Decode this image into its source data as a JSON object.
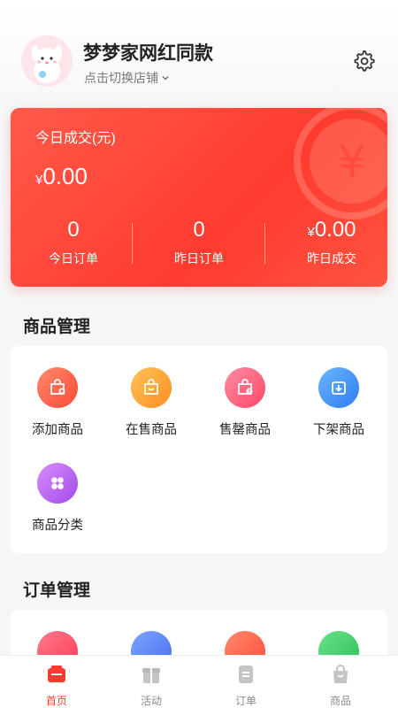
{
  "header": {
    "shop_name": "梦梦家网红同款",
    "switch_label": "点击切换店铺"
  },
  "stats": {
    "title": "今日成交(元)",
    "currency": "¥",
    "today_amount": "0.00",
    "items": [
      {
        "value": "0",
        "label": "今日订单",
        "currency": ""
      },
      {
        "value": "0",
        "label": "昨日订单",
        "currency": ""
      },
      {
        "value": "0.00",
        "label": "昨日成交",
        "currency": "¥"
      }
    ]
  },
  "product_management": {
    "title": "商品管理",
    "items": [
      {
        "label": "添加商品",
        "icon": "bag-add-icon",
        "color": "#ff5a4a"
      },
      {
        "label": "在售商品",
        "icon": "bag-smile-icon",
        "color": "#ffa530"
      },
      {
        "label": "售罄商品",
        "icon": "bag-alert-icon",
        "color": "#ff5a7a"
      },
      {
        "label": "下架商品",
        "icon": "box-down-icon",
        "color": "#3a8ef6"
      },
      {
        "label": "商品分类",
        "icon": "category-icon",
        "color": "#b25ef0"
      }
    ]
  },
  "order_management": {
    "title": "订单管理"
  },
  "tabbar": {
    "items": [
      {
        "label": "首页",
        "icon": "home-icon",
        "active": true
      },
      {
        "label": "活动",
        "icon": "gift-icon",
        "active": false
      },
      {
        "label": "订单",
        "icon": "order-icon",
        "active": false
      },
      {
        "label": "商品",
        "icon": "shopping-bag-icon",
        "active": false
      }
    ]
  },
  "colors": {
    "accent": "#ff3b30",
    "background": "#f6f6f8"
  }
}
